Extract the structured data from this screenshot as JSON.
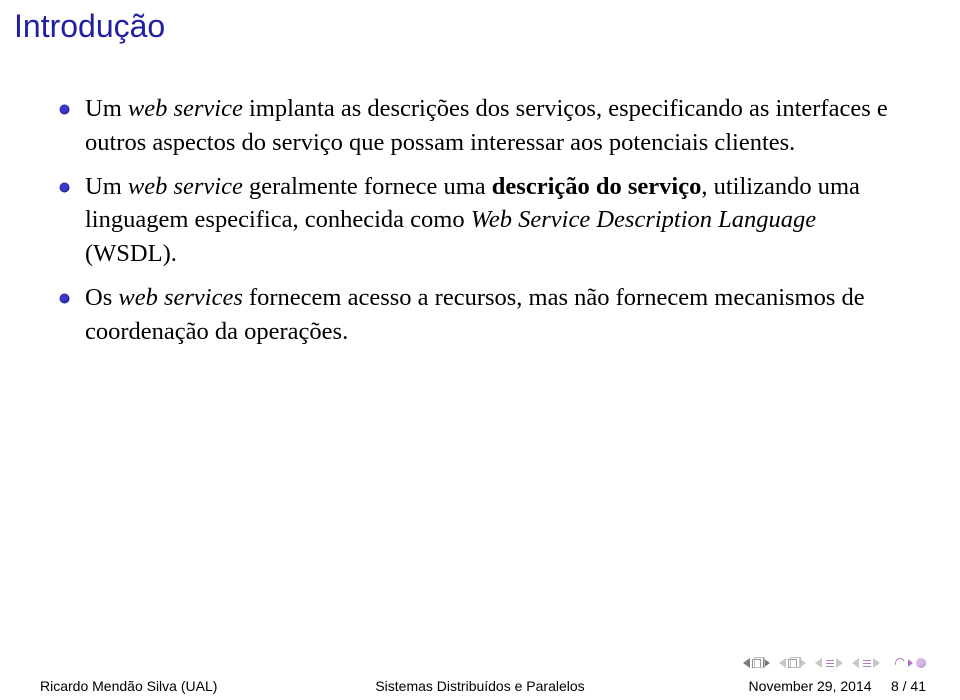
{
  "title": "Introdução",
  "bullets": [
    {
      "pre": "Um ",
      "em1": "web service",
      "mid1": " implanta as descrições dos serviços, especificando as interfaces e outros aspectos do serviço que possam interessar aos potenciais clientes.",
      "bold": "",
      "mid2": "",
      "em2": "",
      "tail": ""
    },
    {
      "pre": "Um ",
      "em1": "web service",
      "mid1": " geralmente fornece uma ",
      "bold": "descrição do serviço",
      "mid2": ", utilizando uma linguagem especifica, conhecida como ",
      "em2": "Web Service Description Language",
      "tail": " (WSDL)."
    },
    {
      "pre": "Os ",
      "em1": "web services",
      "mid1": " fornecem acesso a recursos, mas não fornecem mecanismos de coordenação da operações.",
      "bold": "",
      "mid2": "",
      "em2": "",
      "tail": ""
    }
  ],
  "footer": {
    "left": "Ricardo Mendão Silva (UAL)",
    "center": "Sistemas Distribuídos e Paralelos",
    "date": "November 29, 2014",
    "page": "8 / 41"
  }
}
